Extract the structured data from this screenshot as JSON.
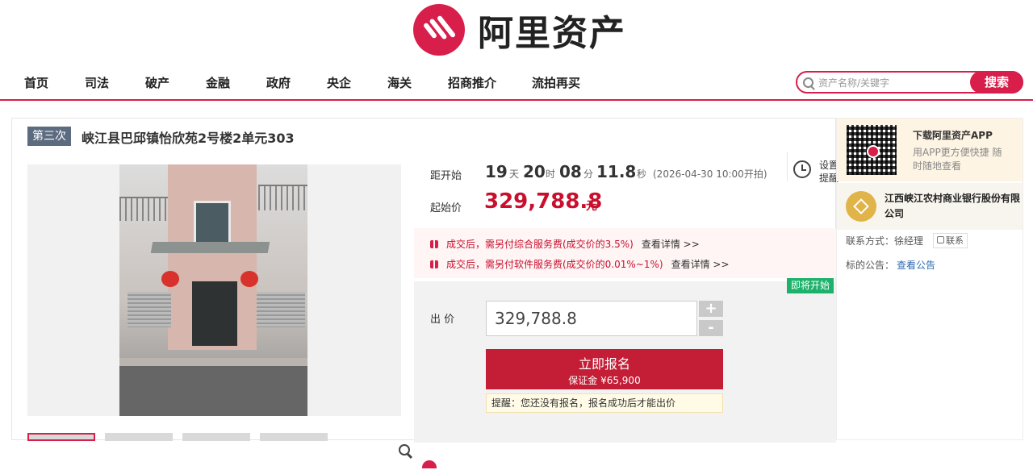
{
  "brand": {
    "name": "阿里资产",
    "accent": "#d81e4a"
  },
  "nav": {
    "items": [
      "首页",
      "司法",
      "破产",
      "金融",
      "政府",
      "央企",
      "海关",
      "招商推介",
      "流拍再买"
    ]
  },
  "search": {
    "placeholder": "资产名称/关键字",
    "button": "搜索"
  },
  "item": {
    "round": "第三次",
    "title": "峡江县巴邱镇怡欣苑2号楼2单元303"
  },
  "countdown": {
    "label": "距开始",
    "days": "19",
    "days_unit": "天",
    "hours": "20",
    "hours_unit": "时",
    "minutes": "08",
    "minutes_unit": "分",
    "seconds": "11.8",
    "seconds_unit": "秒",
    "start_note": "(2026-04-30 10:00开拍)"
  },
  "reminder": {
    "label": "设置提醒"
  },
  "price": {
    "label": "起始价",
    "value": "329,788.8",
    "unit": "元"
  },
  "fees": [
    {
      "text": "成交后，需另付综合服务费(成交价的3.5%)",
      "link": "查看详情 >>"
    },
    {
      "text": "成交后，需另付软件服务费(成交价的0.01%~1%)",
      "link": "查看详情 >>"
    }
  ],
  "bid": {
    "status": "即将开始",
    "label": "出  价",
    "value": "329,788.8",
    "plus": "+",
    "minus": "-",
    "register_label": "立即报名",
    "deposit": "保证金 ¥65,900",
    "tip": "提醒：您还没有报名，报名成功后才能出价"
  },
  "sidebar": {
    "app_title": "下载阿里资产APP",
    "app_desc": "用APP更方便快捷 随时随地查看",
    "bank_name": "江西峡江农村商业银行股份有限公司",
    "contact_label": "联系方式：徐经理",
    "contact_button": "联系",
    "notice_label": "标的公告：",
    "notice_link": "查看公告"
  }
}
